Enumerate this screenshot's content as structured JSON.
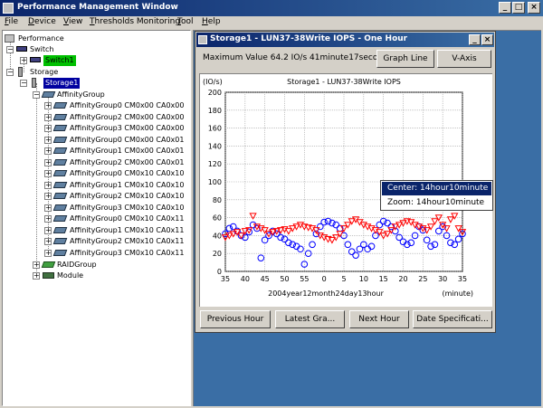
{
  "window": {
    "title": "Performance Management Window"
  },
  "menu": [
    {
      "accel": "F",
      "rest": "ile"
    },
    {
      "accel": "D",
      "rest": "evice"
    },
    {
      "accel": "V",
      "rest": "iew"
    },
    {
      "accel": "T",
      "rest": "hresholds Monitoring"
    },
    {
      "accel": "T",
      "rest": "ool"
    },
    {
      "accel": "H",
      "rest": "elp"
    }
  ],
  "tree": {
    "root": "Performance",
    "switch": "Switch",
    "switch1": "Switch1",
    "storage": "Storage",
    "storage1": "Storage1",
    "affinity_group": "AffinityGroup",
    "affinity_items": [
      "AffinityGroup0 CM0x00 CA0x00",
      "AffinityGroup2 CM0x00 CA0x00",
      "AffinityGroup3 CM0x00 CA0x00",
      "AffinityGroup0 CM0x00 CA0x01",
      "AffinityGroup1 CM0x00 CA0x01",
      "AffinityGroup2 CM0x00 CA0x01",
      "AffinityGroup0 CM0x10 CA0x10",
      "AffinityGroup1 CM0x10 CA0x10",
      "AffinityGroup2 CM0x10 CA0x10",
      "AffinityGroup3 CM0x10 CA0x10",
      "AffinityGroup0 CM0x10 CA0x11",
      "AffinityGroup1 CM0x10 CA0x11",
      "AffinityGroup2 CM0x10 CA0x11",
      "AffinityGroup3 CM0x10 CA0x11"
    ],
    "raid_group": "RAIDGroup",
    "module": "Module"
  },
  "graph_window": {
    "title": "Storage1 - LUN37-38Write IOPS - One Hour",
    "max_value": "Maximum Value  64.2 IO/s  41minute17second",
    "buttons": {
      "graph_line": "Graph Line",
      "v_axis": "V-Axis"
    },
    "bottom_buttons": [
      "Previous Hour",
      "Latest Gra...",
      "Next Hour",
      "Date Specificati..."
    ]
  },
  "context_menu": {
    "items": [
      "Center: 14hour10minute",
      "Zoom: 14hour10minute"
    ],
    "selected_index": 0
  },
  "colors": {
    "series_blue": "#0000ff",
    "series_red": "#ff0000",
    "title_dark": "#0a246a",
    "desktop": "#3a6ea5",
    "selection_green": "#00c000"
  },
  "chart_data": {
    "type": "scatter",
    "title": "Storage1 - LUN37-38Write IOPS",
    "ylabel": "(IO/s)",
    "xlabel": "2004year12month24day13hour",
    "xunit": "(minute)",
    "y_ticks": [
      0,
      20,
      40,
      60,
      80,
      100,
      120,
      140,
      160,
      180,
      200
    ],
    "x_ticks": [
      "35",
      "40",
      "45",
      "50",
      "55",
      "0",
      "5",
      "10",
      "15",
      "20",
      "25",
      "30",
      "35"
    ],
    "ylim": [
      0,
      200
    ],
    "x_start_minute": 35,
    "x_end_minute": 95,
    "grid": true,
    "series": [
      {
        "name": "",
        "marker": "circle",
        "values_by_minute": [
          [
            35,
            42
          ],
          [
            36,
            48
          ],
          [
            37,
            50
          ],
          [
            38,
            45
          ],
          [
            39,
            40
          ],
          [
            40,
            38
          ],
          [
            41,
            44
          ],
          [
            42,
            52
          ],
          [
            43,
            48
          ],
          [
            44,
            15
          ],
          [
            45,
            35
          ],
          [
            46,
            40
          ],
          [
            47,
            45
          ],
          [
            48,
            42
          ],
          [
            49,
            38
          ],
          [
            50,
            36
          ],
          [
            51,
            32
          ],
          [
            52,
            30
          ],
          [
            53,
            28
          ],
          [
            54,
            25
          ],
          [
            55,
            8
          ],
          [
            56,
            20
          ],
          [
            57,
            30
          ],
          [
            58,
            42
          ],
          [
            59,
            50
          ],
          [
            60,
            55
          ],
          [
            61,
            56
          ],
          [
            62,
            54
          ],
          [
            63,
            52
          ],
          [
            64,
            48
          ],
          [
            65,
            40
          ],
          [
            66,
            30
          ],
          [
            67,
            22
          ],
          [
            68,
            18
          ],
          [
            69,
            25
          ],
          [
            70,
            30
          ],
          [
            71,
            25
          ],
          [
            72,
            28
          ],
          [
            73,
            40
          ],
          [
            74,
            52
          ],
          [
            75,
            56
          ],
          [
            76,
            54
          ],
          [
            77,
            50
          ],
          [
            78,
            45
          ],
          [
            79,
            38
          ],
          [
            80,
            33
          ],
          [
            81,
            30
          ],
          [
            82,
            32
          ],
          [
            83,
            40
          ],
          [
            84,
            50
          ],
          [
            85,
            46
          ],
          [
            86,
            35
          ],
          [
            87,
            28
          ],
          [
            88,
            30
          ],
          [
            89,
            45
          ],
          [
            90,
            50
          ],
          [
            91,
            40
          ],
          [
            92,
            32
          ],
          [
            93,
            30
          ],
          [
            94,
            36
          ],
          [
            95,
            42
          ]
        ]
      },
      {
        "name": "",
        "marker": "triangle-down",
        "values_by_minute": [
          [
            35,
            38
          ],
          [
            36,
            40
          ],
          [
            37,
            42
          ],
          [
            38,
            44
          ],
          [
            39,
            40
          ],
          [
            40,
            45
          ],
          [
            41,
            46
          ],
          [
            42,
            62
          ],
          [
            43,
            50
          ],
          [
            44,
            48
          ],
          [
            45,
            46
          ],
          [
            46,
            42
          ],
          [
            47,
            44
          ],
          [
            48,
            45
          ],
          [
            49,
            46
          ],
          [
            50,
            47
          ],
          [
            51,
            45
          ],
          [
            52,
            48
          ],
          [
            53,
            50
          ],
          [
            54,
            52
          ],
          [
            55,
            50
          ],
          [
            56,
            49
          ],
          [
            57,
            48
          ],
          [
            58,
            46
          ],
          [
            59,
            40
          ],
          [
            60,
            38
          ],
          [
            61,
            36
          ],
          [
            62,
            35
          ],
          [
            63,
            38
          ],
          [
            64,
            42
          ],
          [
            65,
            48
          ],
          [
            66,
            52
          ],
          [
            67,
            56
          ],
          [
            68,
            58
          ],
          [
            69,
            55
          ],
          [
            70,
            52
          ],
          [
            71,
            50
          ],
          [
            72,
            48
          ],
          [
            73,
            46
          ],
          [
            74,
            44
          ],
          [
            75,
            40
          ],
          [
            76,
            42
          ],
          [
            77,
            46
          ],
          [
            78,
            50
          ],
          [
            79,
            52
          ],
          [
            80,
            54
          ],
          [
            81,
            56
          ],
          [
            82,
            55
          ],
          [
            83,
            52
          ],
          [
            84,
            50
          ],
          [
            85,
            48
          ],
          [
            86,
            46
          ],
          [
            87,
            50
          ],
          [
            88,
            56
          ],
          [
            89,
            60
          ],
          [
            90,
            52
          ],
          [
            91,
            48
          ],
          [
            92,
            58
          ],
          [
            93,
            62
          ],
          [
            94,
            48
          ],
          [
            95,
            44
          ]
        ]
      }
    ]
  }
}
